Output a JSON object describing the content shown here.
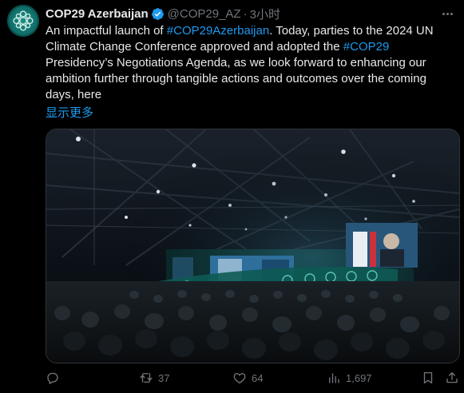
{
  "tweet": {
    "author_name": "COP29 Azerbaijan",
    "handle": "@COP29_AZ",
    "separator": "·",
    "time": "3小时",
    "text_parts": {
      "p1": "An impactful launch of ",
      "hashtag1": "#COP29Azerbaijan",
      "p2": ". Today, parties to the 2024 UN Climate Change Conference approved and adopted the ",
      "hashtag2": "#COP29",
      "p3": " Presidency’s Negotiations Agenda, as we look forward to enhancing our ambition further through tangible actions and outcomes over the coming days, here"
    },
    "show_more": "显示更多"
  },
  "actions": {
    "reply": {
      "icon": "reply-icon",
      "count": ""
    },
    "retweet": {
      "icon": "retweet-icon",
      "count": "37"
    },
    "like": {
      "icon": "heart-icon",
      "count": "64"
    },
    "views": {
      "icon": "views-icon",
      "count": "1,697"
    },
    "bookmark": {
      "icon": "bookmark-icon"
    },
    "share": {
      "icon": "share-icon"
    }
  },
  "colors": {
    "background": "#000000",
    "text": "#e7e9ea",
    "muted": "#71767b",
    "accent": "#1d9bf0",
    "verified": "#1d9bf0"
  }
}
